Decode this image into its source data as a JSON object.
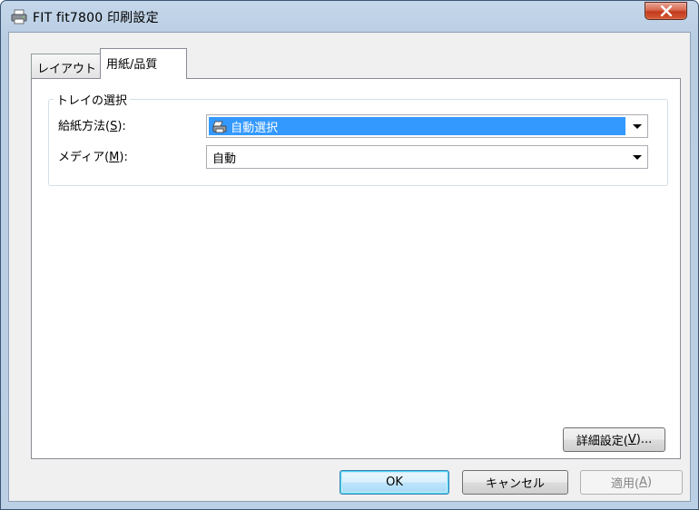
{
  "window": {
    "title": "FIT fit7800 印刷設定",
    "close_label": "x"
  },
  "tabs": [
    {
      "label": "レイアウト",
      "active": false
    },
    {
      "label": "用紙/品質",
      "active": true
    }
  ],
  "tray_group": {
    "label": "トレイの選択",
    "paper_source": {
      "label_pre": "給紙方法(",
      "mnemonic": "S",
      "label_post": "):",
      "value": "自動選択",
      "icon": "printer-feed-icon"
    },
    "media": {
      "label_pre": "メディア(",
      "mnemonic": "M",
      "label_post": "):",
      "value": "自動"
    }
  },
  "advanced_button": {
    "pre": "詳細設定(",
    "mnemonic": "V",
    "post": ")..."
  },
  "buttons": {
    "ok": "OK",
    "cancel": "キャンセル",
    "apply_pre": "適用(",
    "apply_mnemonic": "A",
    "apply_post": ")"
  },
  "colors": {
    "selection": "#3399ff",
    "close_button": "#c2391c",
    "frame": "#bcd0e5"
  }
}
